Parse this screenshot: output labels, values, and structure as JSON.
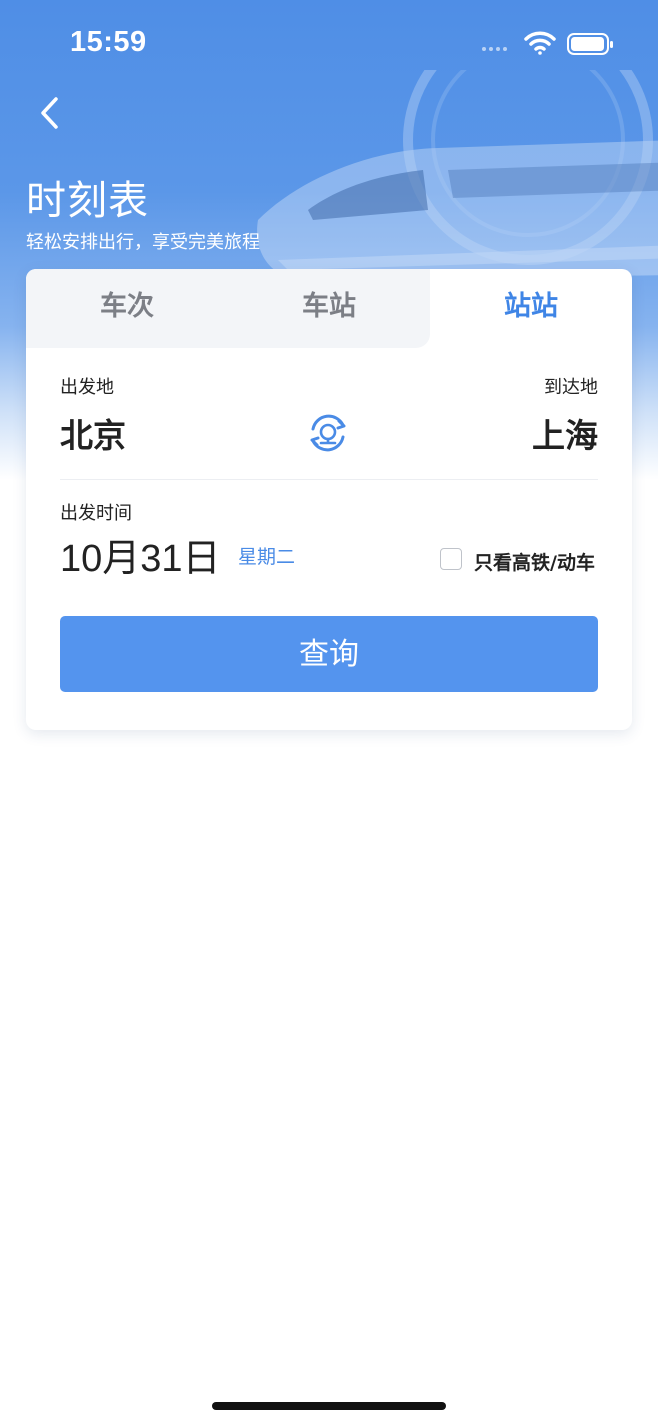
{
  "status_bar": {
    "time": "15:59"
  },
  "header": {
    "title": "时刻表",
    "subtitle": "轻松安排出行，享受完美旅程"
  },
  "tabs": [
    {
      "label": "车次",
      "active": false
    },
    {
      "label": "车站",
      "active": false
    },
    {
      "label": "站站",
      "active": true
    }
  ],
  "form": {
    "departure": {
      "label": "出发地",
      "city": "北京"
    },
    "arrival": {
      "label": "到达地",
      "city": "上海"
    },
    "date": {
      "label": "出发时间",
      "value": "10月31日",
      "weekday": "星期二"
    },
    "high_speed_only": {
      "label": "只看高铁/动车",
      "checked": false
    },
    "query_label": "查询"
  },
  "colors": {
    "accent": "#3f85e6",
    "button": "#5494ee",
    "hero_top": "#4f8ee6"
  },
  "icons": [
    "back-icon",
    "swap-icon",
    "wifi-icon",
    "battery-icon"
  ]
}
